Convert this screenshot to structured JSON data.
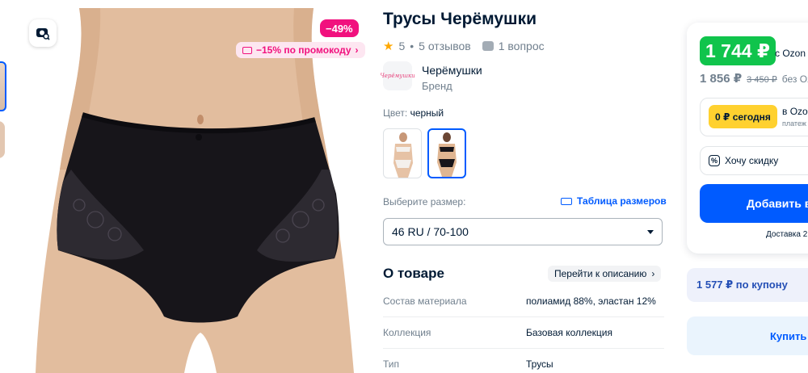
{
  "product": {
    "title": "Трусы Черёмушки",
    "rating": "5",
    "reviews": "5 отзывов",
    "questions": "1 вопрос",
    "brand_name": "Черёмушки",
    "brand_label": "Бренд",
    "brand_logo_text": "Черёмушки"
  },
  "gallery": {
    "discount": "−49%",
    "promo": "−15% по промокоду",
    "promo_chevron": "›"
  },
  "color": {
    "label": "Цвет:",
    "value": "черный",
    "variants": [
      "white",
      "black"
    ]
  },
  "size": {
    "label": "Выберите размер:",
    "table_link": "Таблица размеров",
    "selected": "46 RU / 70-100"
  },
  "about": {
    "heading": "О товаре",
    "goto_description": "Перейти к описанию",
    "specs": [
      {
        "key": "Состав материала",
        "value": "полиамид 88%, эластан 12%"
      },
      {
        "key": "Коллекция",
        "value": "Базовая коллекция"
      },
      {
        "key": "Тип",
        "value": "Трусы"
      }
    ]
  },
  "buy": {
    "ozon_price": "1 744 ₽",
    "ozon_price_note": "с Ozon",
    "price": "1 856 ₽",
    "old_price": "3 450 ₽",
    "price_note": "без Oz",
    "installment_today": "0 ₽ сегодня",
    "installment_ozon": "в Ozon",
    "installment_sub": "платеж",
    "want_discount": "Хочу скидку",
    "add_to_cart": "Добавить в",
    "delivery": "Доставка 2",
    "coupon": "1 577 ₽ по купону",
    "buy_now": "Купить"
  },
  "colors": {
    "accent": "#005bff",
    "ozon_green": "#10c44c",
    "sale_pink": "#f1117e",
    "installment_yellow": "#ffd12f"
  }
}
